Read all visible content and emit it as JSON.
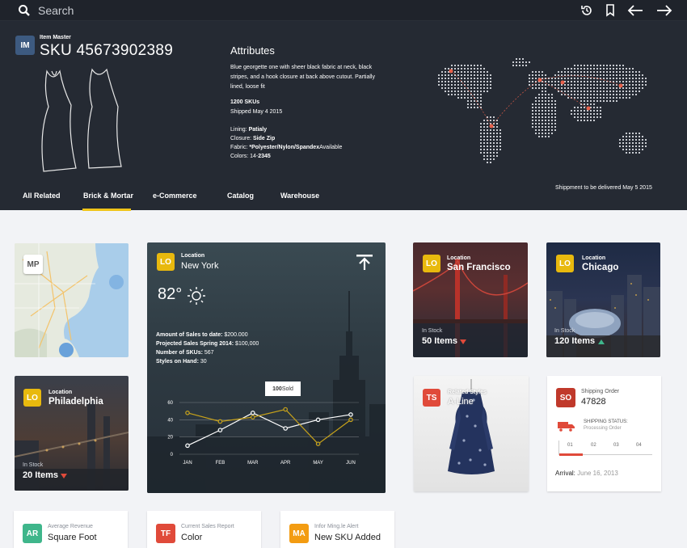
{
  "topbar": {
    "search_placeholder": "Search"
  },
  "item": {
    "badge": "IM",
    "label": "Item Master",
    "sku": "SKU 45673902389"
  },
  "attributes": {
    "title": "Attributes",
    "description": "Blue georgette one with sheer black fabric at neck, black stripes, and a hook closure at back above cutout. Partially lined, loose fit",
    "skus": "1200 SKUs",
    "shipped": "Shipped May 4 2015",
    "lining_label": "Lining: ",
    "lining": "Patialy",
    "closure_label": "Closure: ",
    "closure": "Side Zip",
    "fabric_label": "Fabric: ",
    "fabric": "*Polyester/Nylon/Spandex",
    "fabric_suffix": "Available",
    "colors_label": "Colors: 14-",
    "colors": "2345"
  },
  "shipment_note": "Shippment to be delivered May 5 2015",
  "tabs": [
    {
      "label": "All Related"
    },
    {
      "label": "Brick & Mortar"
    },
    {
      "label": "e-Commerce"
    },
    {
      "label": "Catalog"
    },
    {
      "label": "Warehouse"
    }
  ],
  "map_card": {
    "badge": "MP"
  },
  "ny": {
    "badge": "LO",
    "label": "Location",
    "city": "New York",
    "temp": "82°",
    "stats": [
      {
        "k": "Amount of Sales to date:",
        "v": " $200.000"
      },
      {
        "k": "Projected Sales Spring 2014:",
        "v": " $100,000"
      },
      {
        "k": "Number of SKUs:",
        "v": " 567"
      },
      {
        "k": "Styles on Hand:",
        "v": " 30"
      }
    ],
    "tooltip_bold": "100",
    "tooltip_rest": " Sold"
  },
  "chart_data": {
    "type": "line",
    "categories": [
      "JAN",
      "FEB",
      "MAR",
      "APR",
      "MAY",
      "JUN"
    ],
    "ylim": [
      0,
      60
    ],
    "yticks": [
      0,
      20,
      40,
      60
    ],
    "series": [
      {
        "values": [
          10,
          28,
          48,
          30,
          40,
          46
        ],
        "color": "#ffffff"
      },
      {
        "values": [
          48,
          38,
          43,
          52,
          12,
          40
        ],
        "color": "#c7a21a"
      }
    ]
  },
  "sf": {
    "badge": "LO",
    "label": "Location",
    "city": "San Francisco",
    "instock": "In Stock",
    "items": "50 Items",
    "trend": "down"
  },
  "chi": {
    "badge": "LO",
    "label": "Location",
    "city": "Chicago",
    "instock": "In Stock",
    "items": "120 Items",
    "trend": "up"
  },
  "phl": {
    "badge": "LO",
    "label": "Location",
    "city": "Philadelphia",
    "instock": "In Stock",
    "items": "20 Items",
    "trend": "down"
  },
  "styles": {
    "badge": "TS",
    "label": "Related Styles",
    "value": "A-Line"
  },
  "shipping": {
    "badge": "SO",
    "label": "Shipping Order",
    "number": "47828",
    "status_label": "SHIPPING STATUS:",
    "status": "Processing Order",
    "steps": [
      "01",
      "02",
      "03",
      "04"
    ],
    "arrival_label": "Arrival:",
    "arrival": " June 16, 2013",
    "progress": 0.25
  },
  "bottom": [
    {
      "badge": "AR",
      "label": "Average Revenue",
      "value": "Square Foot",
      "color": "#3fb68b"
    },
    {
      "badge": "TF",
      "label": "Current Sales Report",
      "value": "Color",
      "color": "#e04a3a"
    },
    {
      "badge": "MA",
      "label": "Infor Ming.le Alert",
      "value": "New SKU Added",
      "color": "#f39c12"
    }
  ],
  "colors": {
    "accent": "#f0c419",
    "loc_badge": "#e8b90e",
    "so_badge": "#c0392b",
    "ts_badge": "#e04a3a"
  }
}
